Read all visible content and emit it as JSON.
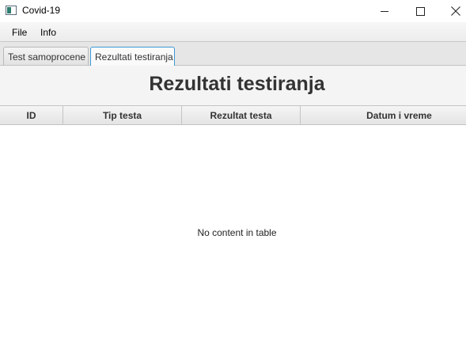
{
  "window": {
    "title": "Covid-19"
  },
  "menu": {
    "items": [
      "File",
      "Info"
    ]
  },
  "tabs": [
    {
      "label": "Test samoprocene",
      "selected": false
    },
    {
      "label": "Rezultati testiranja",
      "selected": true
    }
  ],
  "main": {
    "title": "Rezultati testiranja"
  },
  "table": {
    "columns": [
      "ID",
      "Tip testa",
      "Rezultat testa",
      "Datum i vreme"
    ],
    "rows": [],
    "placeholder": "No content in table"
  },
  "colors": {
    "selected_tab_border": "#3c9ad6",
    "title_color": "#333333"
  },
  "icons": {
    "app": "app-window-icon",
    "minimize": "minimize-icon",
    "maximize": "maximize-icon",
    "close": "close-icon"
  }
}
